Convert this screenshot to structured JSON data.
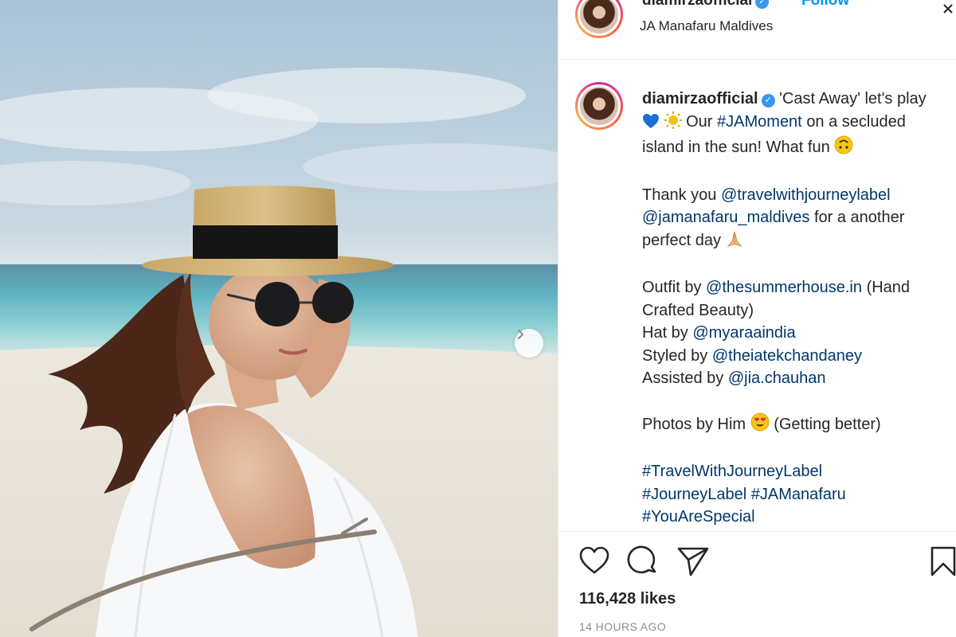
{
  "post": {
    "username": "diamirzaofficial",
    "separator": "•",
    "follow_label": "Follow",
    "location": "JA Manafaru Maldives"
  },
  "caption": {
    "username": "diamirzaofficial",
    "line1_text": "'Cast Away' let's play",
    "line1_after": "Our",
    "hashtag_moment": "#JAMoment",
    "line1_end": "on a secluded island in the sun! What fun",
    "thanks_text": "Thank you",
    "mention_travel": "@travelwithjourneylabel",
    "mention_jamanafaru": "@jamanafaru_maldives",
    "thanks_end": "for a another perfect day",
    "outfit_text": "Outfit by",
    "mention_summerhouse": "@thesummerhouse.in",
    "outfit_end": "(Hand Crafted Beauty)",
    "hat_text": "Hat by",
    "mention_myaraa": "@myaraaindia",
    "styled_text": "Styled by",
    "mention_theia": "@theiatekchandaney",
    "assisted_text": "Assisted by",
    "mention_jia": "@jia.chauhan",
    "photos_text": "Photos by Him",
    "photos_end": "(Getting better)",
    "hashtag_1": "#TravelWithJourneyLabel",
    "hashtag_2": "#JourneyLabel",
    "hashtag_3": "#JAManafaru",
    "hashtag_4": "#YouAreSpecial"
  },
  "stats": {
    "likes": "116,428 likes",
    "time": "14 HOURS AGO"
  },
  "icons": {
    "like": "heart-icon",
    "comment": "comment-icon",
    "share": "send-icon",
    "save": "bookmark-icon",
    "next": "chevron-right-icon",
    "verified": "verified-badge-icon"
  },
  "colors": {
    "link": "#00376b",
    "follow": "#0095f6",
    "verified": "#3897f0",
    "timestamp": "#8e8e8e"
  }
}
